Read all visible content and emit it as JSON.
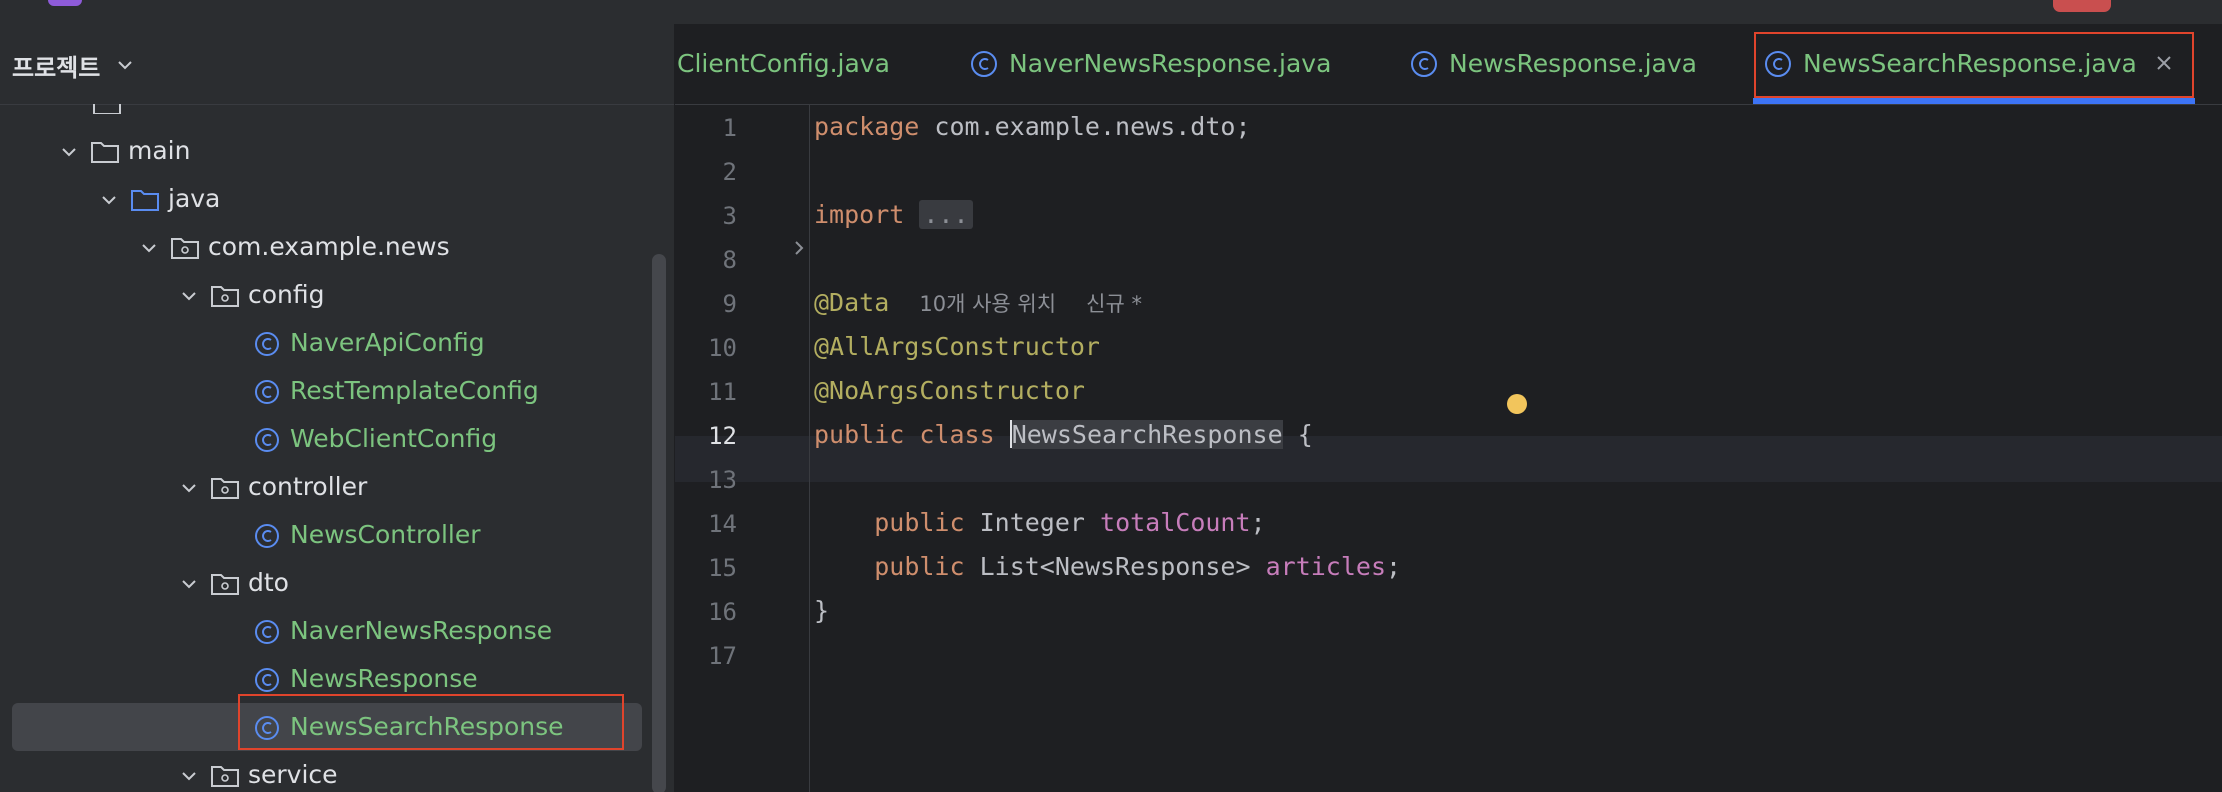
{
  "sidebar": {
    "title": "프로젝트",
    "tree": [
      {
        "label": "main",
        "type": "folder",
        "expanded": true
      },
      {
        "label": "java",
        "type": "source-folder",
        "expanded": true
      },
      {
        "label": "com.example.news",
        "type": "package",
        "expanded": true
      },
      {
        "label": "config",
        "type": "package",
        "expanded": true
      },
      {
        "label": "NaverApiConfig",
        "type": "class"
      },
      {
        "label": "RestTemplateConfig",
        "type": "class"
      },
      {
        "label": "WebClientConfig",
        "type": "class"
      },
      {
        "label": "controller",
        "type": "package",
        "expanded": true
      },
      {
        "label": "NewsController",
        "type": "class"
      },
      {
        "label": "dto",
        "type": "package",
        "expanded": true
      },
      {
        "label": "NaverNewsResponse",
        "type": "class"
      },
      {
        "label": "NewsResponse",
        "type": "class"
      },
      {
        "label": "NewsSearchResponse",
        "type": "class",
        "selected": true
      },
      {
        "label": "service",
        "type": "package",
        "expanded": true
      }
    ]
  },
  "tabs": [
    {
      "label": "ClientConfig.java",
      "active": false
    },
    {
      "label": "NaverNewsResponse.java",
      "active": false
    },
    {
      "label": "NewsResponse.java",
      "active": false
    },
    {
      "label": "NewsSearchResponse.java",
      "active": true
    }
  ],
  "editor": {
    "line_numbers": [
      "1",
      "2",
      "3",
      "8",
      "9",
      "10",
      "11",
      "12",
      "13",
      "14",
      "15",
      "16",
      "17"
    ],
    "current_line": "12",
    "code": {
      "package_kw": "package",
      "package_name": "com.example.news.dto;",
      "import_kw": "import",
      "import_fold": "...",
      "ann_data": "@Data",
      "usage_hint": "10개 사용 위치",
      "new_hint": "신규 *",
      "ann_allargs": "@AllArgsConstructor",
      "ann_noargs": "@NoArgsConstructor",
      "public_kw": "public",
      "class_kw": "class",
      "class_name": "NewsSearchResponse",
      "open_brace": "{",
      "field1_type": "Integer",
      "field1_name": "totalCount",
      "field2_type": "List<NewsResponse>",
      "field2_name": "articles",
      "semicolon": ";",
      "close_brace": "}"
    }
  },
  "colors": {
    "accent": "#3d74f6",
    "highlight_box": "#e0442c",
    "class_name_green": "#7cc47f",
    "keyword": "#cf8e6d",
    "annotation": "#b3ae60"
  }
}
